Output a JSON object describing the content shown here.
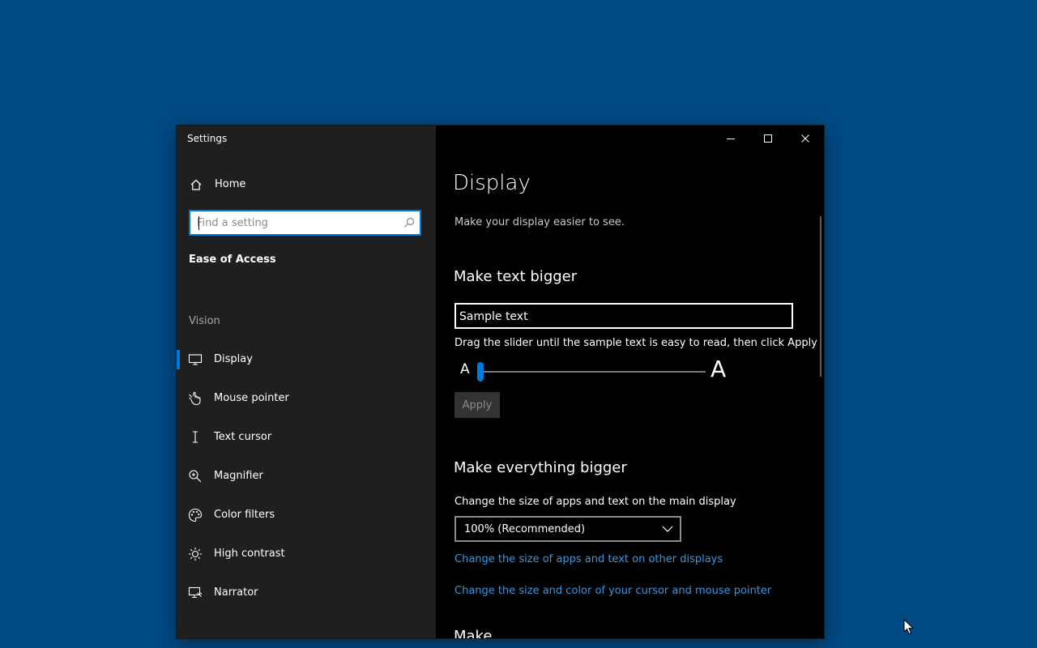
{
  "window": {
    "title": "Settings",
    "controls": {
      "minimize": "minimize",
      "maximize": "maximize",
      "close": "close"
    }
  },
  "sidebar": {
    "home_label": "Home",
    "search_placeholder": "Find a setting",
    "category": "Ease of Access",
    "group_label": "Vision",
    "items": [
      {
        "label": "Display",
        "icon": "display-icon",
        "selected": true
      },
      {
        "label": "Mouse pointer",
        "icon": "mouse-pointer-icon",
        "selected": false
      },
      {
        "label": "Text cursor",
        "icon": "text-cursor-icon",
        "selected": false
      },
      {
        "label": "Magnifier",
        "icon": "magnifier-icon",
        "selected": false
      },
      {
        "label": "Color filters",
        "icon": "color-filters-icon",
        "selected": false
      },
      {
        "label": "High contrast",
        "icon": "high-contrast-icon",
        "selected": false
      },
      {
        "label": "Narrator",
        "icon": "narrator-icon",
        "selected": false
      }
    ]
  },
  "main": {
    "title": "Display",
    "subtitle": "Make your display easier to see.",
    "text_bigger": {
      "heading": "Make text bigger",
      "sample_text": "Sample text",
      "hint": "Drag the slider until the sample text is easy to read, then click Apply",
      "small_a": "A",
      "large_a": "A",
      "slider_value": 0,
      "apply_label": "Apply"
    },
    "everything_bigger": {
      "heading": "Make everything bigger",
      "label": "Change the size of apps and text on the main display",
      "scale_value": "100% (Recommended)",
      "link_other_displays": "Change the size of apps and text on other displays",
      "link_cursor": "Change the size and color of your cursor and mouse pointer"
    },
    "next_heading_partial": "Make ..."
  },
  "accent_color": "#0078d7",
  "link_color": "#3a96dd"
}
